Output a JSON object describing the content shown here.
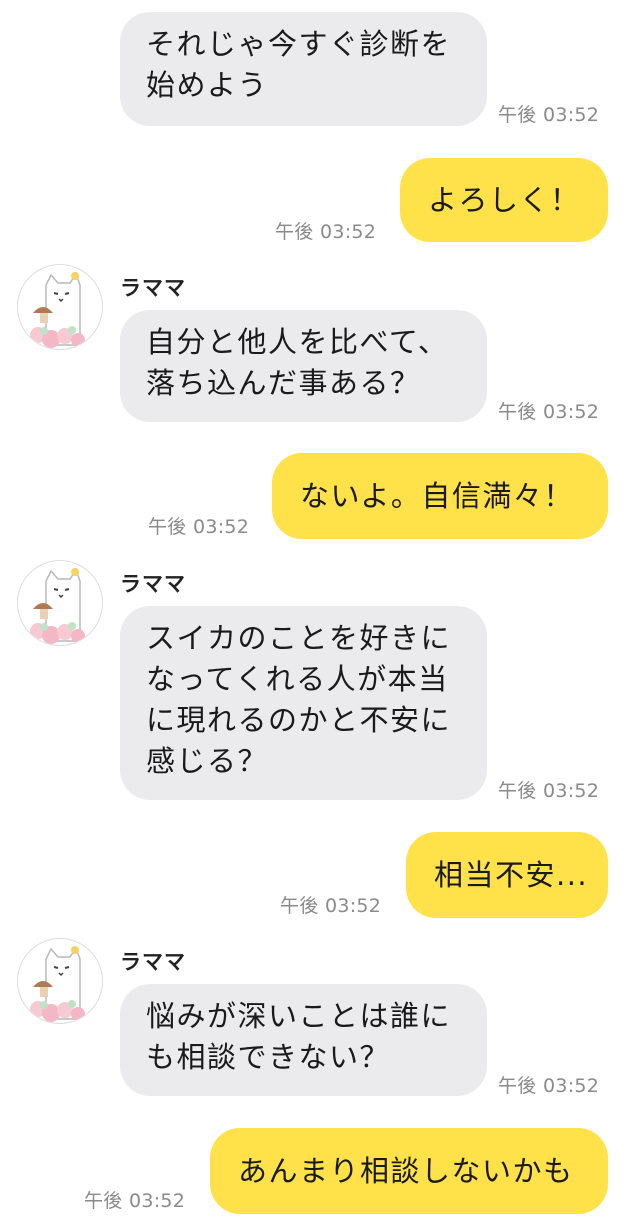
{
  "chat": {
    "partner_name": "ラママ",
    "messages": [
      {
        "from": "partner",
        "text": "それじゃ今すぐ診断を\n始めよう",
        "time": "午後 03:52"
      },
      {
        "from": "me",
        "text": "よろしく！",
        "time": "午後 03:52"
      },
      {
        "from": "partner",
        "sender": "ラママ",
        "text": "自分と他人を比べて、\n落ち込んだ事ある？",
        "time": "午後 03:52"
      },
      {
        "from": "me",
        "text": "ないよ。自信満々！",
        "time": "午後 03:52"
      },
      {
        "from": "partner",
        "sender": "ラママ",
        "text": "スイカのことを好きに\nなってくれる人が本当\nに現れるのかと不安に\n感じる？",
        "time": "午後 03:52"
      },
      {
        "from": "me",
        "text": "相当不安...",
        "time": "午後 03:52"
      },
      {
        "from": "partner",
        "sender": "ラママ",
        "text": "悩みが深いことは誰に\nも相談できない？",
        "time": "午後 03:52"
      },
      {
        "from": "me",
        "text": "あんまり相談しないかも",
        "time": "午後 03:52"
      }
    ]
  },
  "colors": {
    "incoming_bubble": "#ebebee",
    "outgoing_bubble": "#ffe14a",
    "timestamp": "#8a8a8a"
  },
  "icons": {
    "avatar": "cat-avatar-icon"
  }
}
